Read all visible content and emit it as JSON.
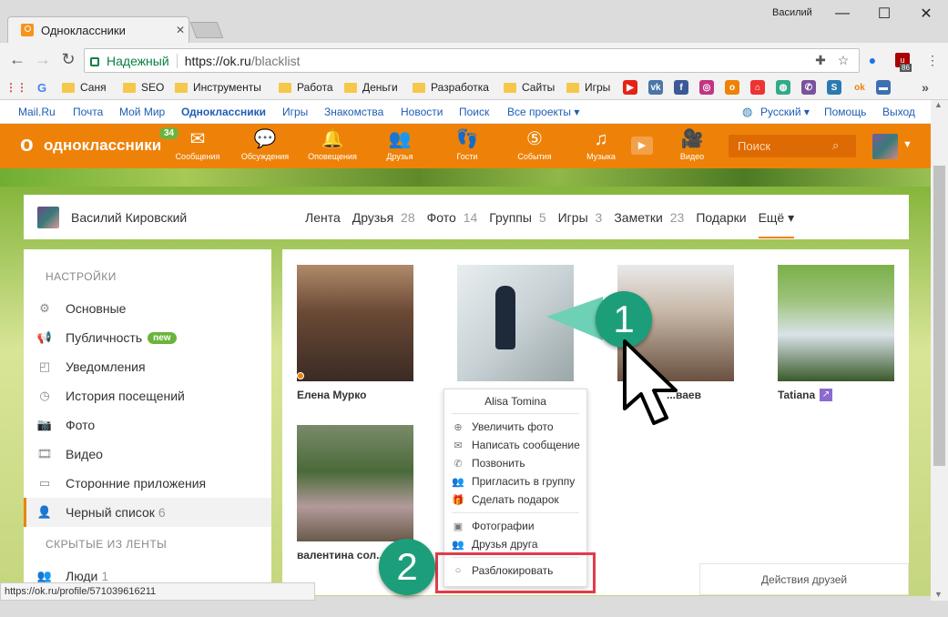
{
  "browser": {
    "tab_title": "Одноклассники",
    "window_user": "Василий",
    "secure_label": "Надежный",
    "url_base": "https://ok.ru",
    "url_path": "/blacklist",
    "ext_badge": "86",
    "bookmarks": [
      "Саня",
      "SEO",
      "Инструменты",
      "Работа",
      "Деньги",
      "Разработка",
      "Сайты",
      "Игры"
    ],
    "status_url": "https://ok.ru/profile/571039616211"
  },
  "toplinks": {
    "left": [
      "Mail.Ru",
      "Почта",
      "Мой Мир",
      "Одноклассники",
      "Игры",
      "Знакомства",
      "Новости",
      "Поиск",
      "Все проекты ▾"
    ],
    "lang": "Русский ▾",
    "help": "Помощь",
    "logout": "Выход"
  },
  "okbar": {
    "logo": "одноклассники",
    "badge": "34",
    "items": [
      "Сообщения",
      "Обсуждения",
      "Оповещения",
      "Друзья",
      "Гости",
      "События",
      "Музыка",
      "Видео"
    ],
    "search_placeholder": "Поиск"
  },
  "profile": {
    "name": "Василий Кировский",
    "tabs": [
      {
        "label": "Лента",
        "count": ""
      },
      {
        "label": "Друзья",
        "count": "28"
      },
      {
        "label": "Фото",
        "count": "14"
      },
      {
        "label": "Группы",
        "count": "5"
      },
      {
        "label": "Игры",
        "count": "3"
      },
      {
        "label": "Заметки",
        "count": "23"
      },
      {
        "label": "Подарки",
        "count": ""
      },
      {
        "label": "Ещё ▾",
        "count": ""
      }
    ]
  },
  "sidebar": {
    "heading": "НАСТРОЙКИ",
    "items": [
      {
        "label": "Основные",
        "icon": "gear-icon"
      },
      {
        "label": "Публичность",
        "icon": "megaphone-icon",
        "tag": "new"
      },
      {
        "label": "Уведомления",
        "icon": "notification-icon"
      },
      {
        "label": "История посещений",
        "icon": "history-icon"
      },
      {
        "label": "Фото",
        "icon": "camera-icon"
      },
      {
        "label": "Видео",
        "icon": "film-icon"
      },
      {
        "label": "Сторонние приложения",
        "icon": "app-icon"
      },
      {
        "label": "Черный список",
        "icon": "blocked-user-icon",
        "count": "6"
      }
    ],
    "heading2": "СКРЫТЫЕ ИЗ ЛЕНТЫ",
    "people_label": "Люди",
    "people_count": "1"
  },
  "blacklist": {
    "users": [
      "Елена Мурко",
      "Alisa Tomina",
      "...ваев",
      "Tatiana",
      "валентина сол..."
    ]
  },
  "popup": {
    "name": "Alisa Tomina",
    "items": [
      "Увеличить фото",
      "Написать сообщение",
      "Позвонить",
      "Пригласить в группу",
      "Сделать подарок"
    ],
    "items2": [
      "Фотографии",
      "Друзья друга"
    ],
    "unblock": "Разблокировать"
  },
  "friends_actions": "Действия друзей",
  "callouts": [
    "1",
    "2"
  ]
}
